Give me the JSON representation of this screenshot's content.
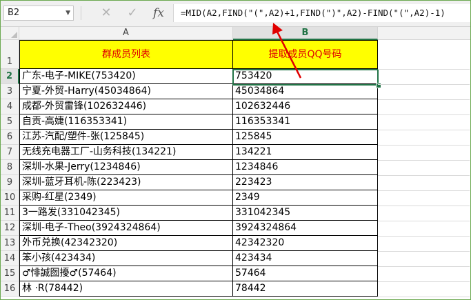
{
  "name_box": "B2",
  "name_box_dropdown_icon": "chevron-down-icon",
  "formula_icons": [
    "cancel-icon",
    "enter-check-icon",
    "function-icon"
  ],
  "formula_fx_label": "fx",
  "formula": "=MID(A2,FIND(\"(\",A2)+1,FIND(\")\",A2)-FIND(\"(\",A2)-1)",
  "columns": [
    "A",
    "B"
  ],
  "selected_column": "B",
  "selected_row": "2",
  "row_numbers": [
    "1",
    "2",
    "3",
    "4",
    "5",
    "6",
    "7",
    "8",
    "9",
    "10",
    "11",
    "12",
    "13",
    "14",
    "15",
    "16"
  ],
  "headers": {
    "a": "群成员列表",
    "b": "提取成员QQ号码"
  },
  "rows": [
    {
      "a": "广东-电子-MIKE(753420)",
      "b": "753420"
    },
    {
      "a": "宁夏-外贸-Harry(45034864)",
      "b": "45034864"
    },
    {
      "a": "成都-外贸雷锋(102632446)",
      "b": "102632446"
    },
    {
      "a": "自贡-高婕(116353341)",
      "b": "116353341"
    },
    {
      "a": "江苏-汽配/塑件-张(125845)",
      "b": "125845"
    },
    {
      "a": "无线充电器工厂-山务科技(134221)",
      "b": "134221"
    },
    {
      "a": "深圳-水果-Jerry(1234846)",
      "b": "1234846"
    },
    {
      "a": "深圳-蓝牙耳机-陈(223423)",
      "b": "223423"
    },
    {
      "a": "采购-红星(2349)",
      "b": "2349"
    },
    {
      "a": "3一路发(331042345)",
      "b": "331042345"
    },
    {
      "a": "深圳-电子-Theo(3924324864)",
      "b": "3924324864"
    },
    {
      "a": "外币兑换(42342320)",
      "b": "42342320"
    },
    {
      "a": "笨小孩(423434)",
      "b": "423434"
    },
    {
      "a": "♂悱誠囫擾♂(57464)",
      "b": "57464"
    },
    {
      "a": "林 ·R(78442)",
      "b": "78442"
    }
  ],
  "colors": {
    "header_fill": "#ffff00",
    "header_text": "#e00000",
    "selection": "#217346",
    "arrow": "#e00000"
  }
}
